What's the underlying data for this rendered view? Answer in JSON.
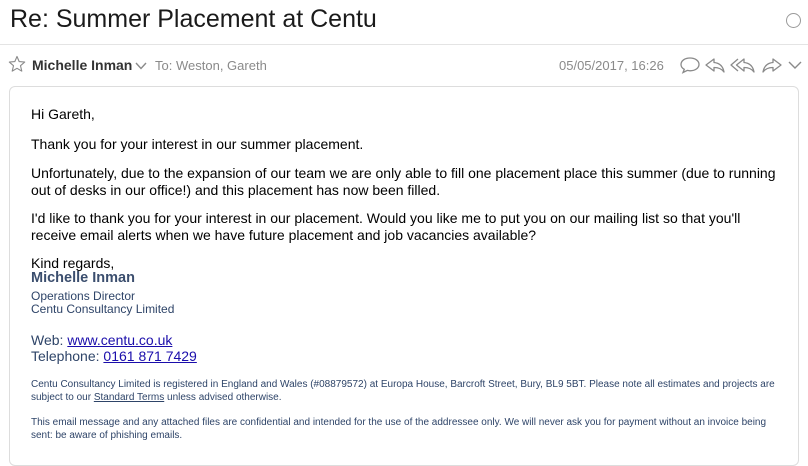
{
  "subject": "Re: Summer Placement at Centu",
  "header": {
    "sender": "Michelle Inman",
    "to_label": "To:",
    "to_names": "Weston, Gareth",
    "date": "05/05/2017, 16:26"
  },
  "icons": {
    "star": "star-icon",
    "expand": "chevron-down-icon",
    "conversation": "speech-bubble-icon",
    "reply": "reply-icon",
    "reply_all": "reply-all-icon",
    "forward": "forward-icon",
    "more": "chevron-down-icon"
  },
  "body": {
    "greeting": "Hi Gareth,",
    "para1": "Thank you for your interest in our summer placement.",
    "para2": "Unfortunately, due to the expansion of our team we are only able to fill one placement place this summer (due to running out of desks in our office!) and this placement has now been filled.",
    "para3": "I'd like to thank you for your interest in our placement. Would you like me to put you on our mailing list so that you'll receive email alerts when we have future placement and job vacancies available?",
    "closing": "Kind regards,"
  },
  "signature": {
    "name": "Michelle Inman",
    "title": "Operations Director",
    "company": "Centu Consultancy Limited",
    "web_label": "Web:",
    "web_link": "www.centu.co.uk",
    "phone_label": "Telephone:",
    "phone_link": "0161 871 7429"
  },
  "footer": {
    "legal_pre": "Centu Consultancy Limited is registered in England and Wales (#08879572) at Europa House, Barcroft Street, Bury, BL9 5BT. Please note all estimates and projects are subject to our",
    "legal_link": "Standard Terms",
    "legal_post": "unless advised otherwise.",
    "confidentiality": "This email message and any attached files are confidential and intended for the use of the addressee only. We will never ask you for payment without an invoice being sent: be aware of phishing emails."
  },
  "colors": {
    "link": "#1a0dab",
    "signature": "#2e4468",
    "meta_gray": "#8a8a8a"
  }
}
